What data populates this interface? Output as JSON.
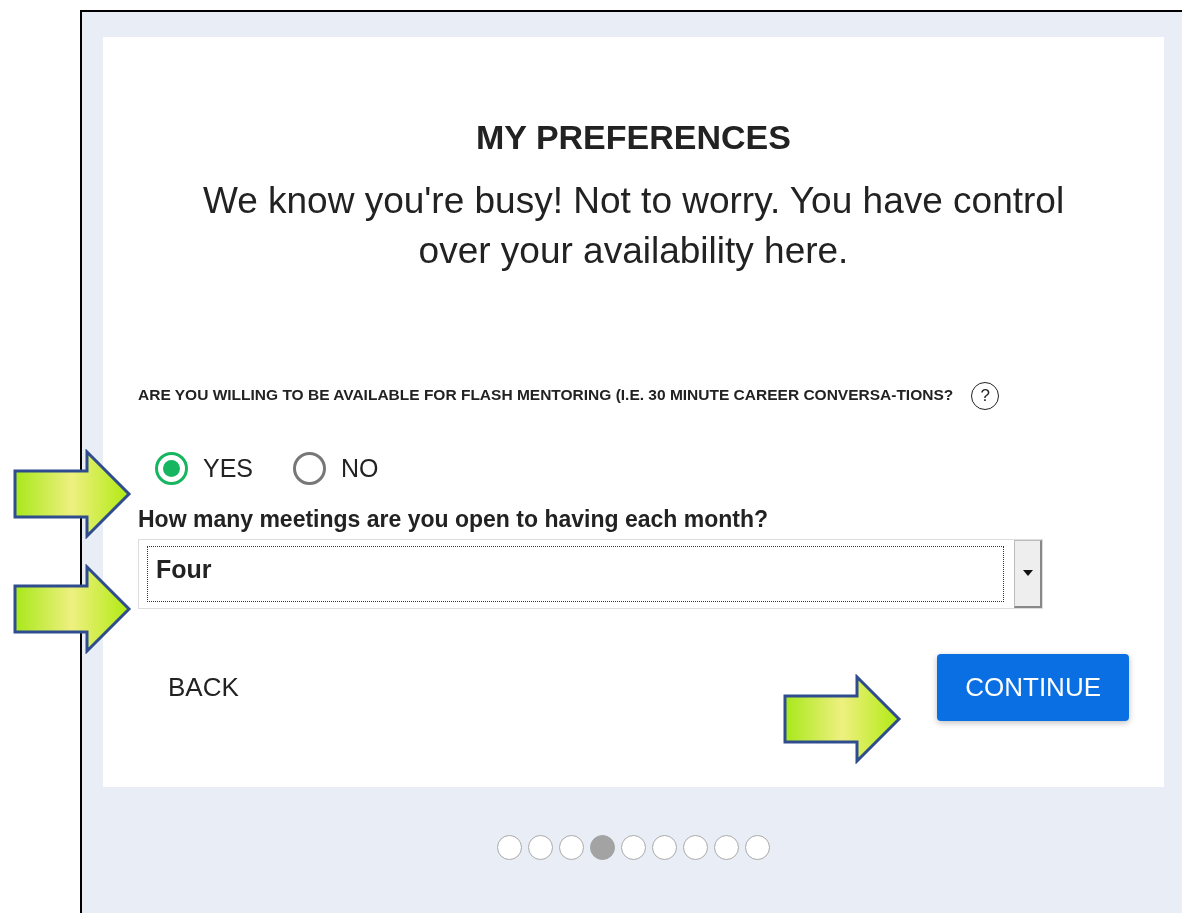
{
  "title": "MY PREFERENCES",
  "subtitle": "We know you're busy! Not to worry. You have control over your availability here.",
  "question": {
    "text": "ARE YOU WILLING TO BE AVAILABLE FOR FLASH MENTORING (I.E. 30 MINUTE CAREER CONVERSA-TIONS?",
    "help": "?"
  },
  "options": [
    {
      "label": "YES",
      "selected": true
    },
    {
      "label": "NO",
      "selected": false
    }
  ],
  "meetings": {
    "label": "How many meetings are you open to having each month?",
    "value": "Four"
  },
  "buttons": [
    {
      "label": "BACK",
      "kind": "text"
    },
    {
      "label": "CONTINUE",
      "kind": "primary"
    }
  ],
  "pager": [
    {
      "selected": false
    },
    {
      "selected": false
    },
    {
      "selected": false
    },
    {
      "selected": true
    },
    {
      "selected": false
    },
    {
      "selected": false
    },
    {
      "selected": false
    },
    {
      "selected": false
    },
    {
      "selected": false
    }
  ]
}
